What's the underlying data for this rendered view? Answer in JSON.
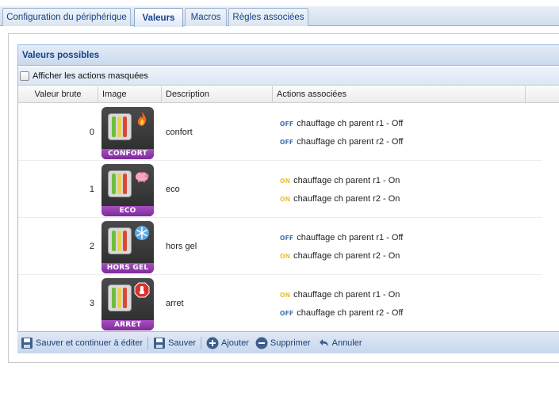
{
  "tabs": [
    {
      "label": "Configuration du périphérique"
    },
    {
      "label": "Valeurs"
    },
    {
      "label": "Macros"
    },
    {
      "label": "Règles associées"
    }
  ],
  "grid": {
    "title": "Valeurs possibles",
    "show_hidden_label": "Afficher les actions masquées",
    "columns": [
      "Valeur brute",
      "Image",
      "Description",
      "Actions associées"
    ]
  },
  "rows": [
    {
      "value": "0",
      "description": "confort",
      "image_label": "CONFORT",
      "image_icon": "flame-icon",
      "actions": [
        {
          "state": "OFF",
          "text": "chauffage ch parent r1 - Off"
        },
        {
          "state": "OFF",
          "text": "chauffage ch parent r2 - Off"
        }
      ]
    },
    {
      "value": "1",
      "description": "eco",
      "image_label": "ECO",
      "image_icon": "piggy-bank-icon",
      "actions": [
        {
          "state": "ON",
          "text": "chauffage ch parent r1 - On"
        },
        {
          "state": "ON",
          "text": "chauffage ch parent r2 - On"
        }
      ]
    },
    {
      "value": "2",
      "description": "hors gel",
      "image_label": "HORS GEL",
      "image_icon": "snowflake-icon",
      "actions": [
        {
          "state": "OFF",
          "text": "chauffage ch parent r1 - Off"
        },
        {
          "state": "ON",
          "text": "chauffage ch parent r2 - On"
        }
      ]
    },
    {
      "value": "3",
      "description": "arret",
      "image_label": "ARRET",
      "image_icon": "stop-hand-icon",
      "actions": [
        {
          "state": "ON",
          "text": "chauffage ch parent r1 - On"
        },
        {
          "state": "OFF",
          "text": "chauffage ch parent r2 - Off"
        }
      ]
    }
  ],
  "toolbar": {
    "save_continue": "Sauver et continuer à éditer",
    "save": "Sauver",
    "add": "Ajouter",
    "delete": "Supprimer",
    "cancel": "Annuler"
  },
  "colors": {
    "off_badge": "#3a6fb0",
    "on_badge": "#e8c23a",
    "image_label_bg": "#8f36ab"
  }
}
